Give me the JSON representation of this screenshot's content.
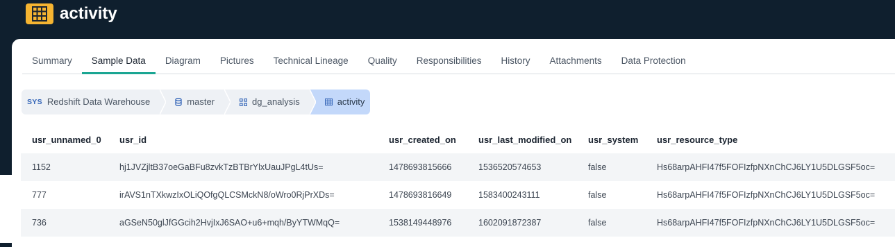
{
  "app": {
    "title": "activity",
    "icon": "table-icon",
    "accent": "#f5b431"
  },
  "tabs": [
    {
      "label": "Summary"
    },
    {
      "label": "Sample Data",
      "active": true
    },
    {
      "label": "Diagram"
    },
    {
      "label": "Pictures"
    },
    {
      "label": "Technical Lineage"
    },
    {
      "label": "Quality"
    },
    {
      "label": "Responsibilities"
    },
    {
      "label": "History"
    },
    {
      "label": "Attachments"
    },
    {
      "label": "Data Protection"
    }
  ],
  "breadcrumb": {
    "system_tag": "SYS",
    "items": [
      {
        "label": "Redshift Data Warehouse",
        "icon": "system-icon"
      },
      {
        "label": "master",
        "icon": "database-icon"
      },
      {
        "label": "dg_analysis",
        "icon": "schema-icon"
      },
      {
        "label": "activity",
        "icon": "table-icon"
      }
    ]
  },
  "table": {
    "columns": [
      "usr_unnamed_0",
      "usr_id",
      "usr_created_on",
      "usr_last_modified_on",
      "usr_system",
      "usr_resource_type"
    ],
    "rows": [
      [
        "1152",
        "hj1JVZjltB37oeGaBFu8zvkTzBTBrYlxUauJPgL4tUs=",
        "1478693815666",
        "1536520574653",
        "false",
        "Hs68arpAHFI47f5FOFIzfpNXnChCJ6LY1U5DLGSF5oc="
      ],
      [
        "777",
        "irAVS1nTXkwzIxOLiQOfgQLCSMckN8/oWro0RjPrXDs=",
        "1478693816649",
        "1583400243111",
        "false",
        "Hs68arpAHFI47f5FOFIzfpNXnChCJ6LY1U5DLGSF5oc="
      ],
      [
        "736",
        "aGSeN50glJfGGcih2HvjIxJ6SAO+u6+mqh/ByYTWMqQ=",
        "1538149448976",
        "1602091872387",
        "false",
        "Hs68arpAHFI47f5FOFIzfpNXnChCJ6LY1U5DLGSF5oc="
      ]
    ]
  }
}
